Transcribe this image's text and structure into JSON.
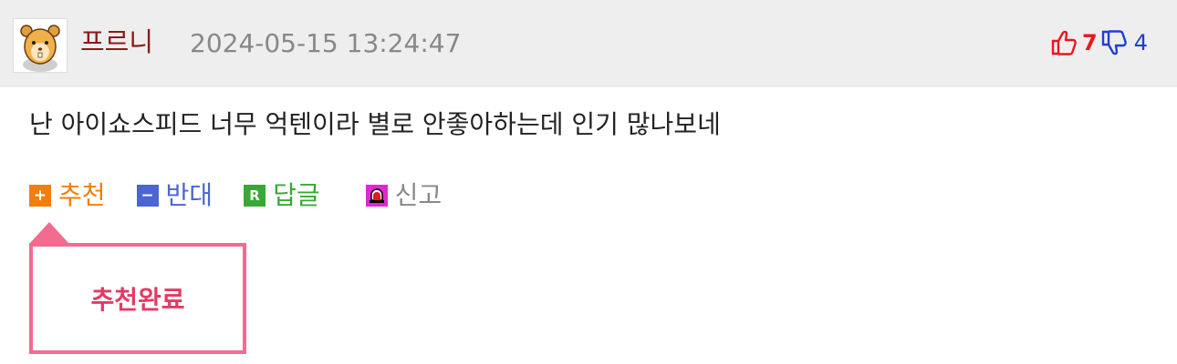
{
  "comment": {
    "nickname": "프르니",
    "datetime": "2024-05-15 13:24:47",
    "up_votes": "7",
    "down_votes": "4",
    "text": "난 아이쇼스피드 너무 억텐이라 별로 안좋아하는데 인기 많나보네"
  },
  "actions": {
    "recommend": {
      "icon": "+",
      "label": "추천"
    },
    "oppose": {
      "icon": "−",
      "label": "반대"
    },
    "reply": {
      "icon": "R",
      "label": "답글"
    },
    "report": {
      "label": "신고"
    }
  },
  "tooltip": {
    "text": "추천완료"
  },
  "colors": {
    "nickname": "#8b1a1a",
    "up": "#e8171e",
    "down": "#1e3ed6",
    "recommend": "#f07f0c",
    "oppose": "#4b66cf",
    "reply": "#3aa837",
    "report_icon": "#e028d0",
    "tooltip_border": "#f46b90",
    "tooltip_text": "#e33b63"
  },
  "icons": {
    "avatar": "hamster-avatar",
    "up": "thumbs-up-icon",
    "down": "thumbs-down-icon",
    "report": "siren-icon"
  }
}
